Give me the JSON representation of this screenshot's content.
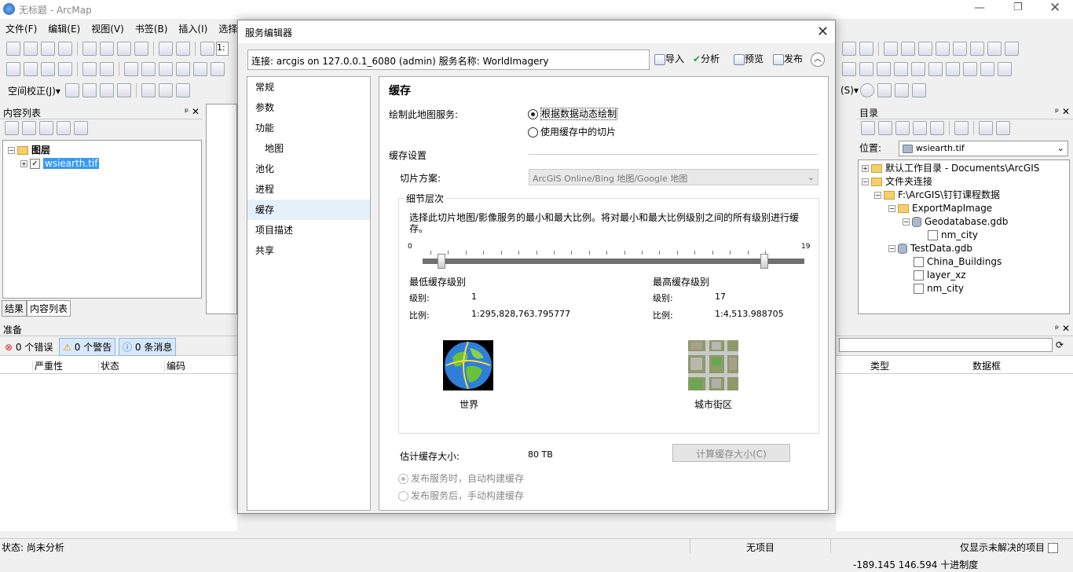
{
  "app": {
    "title": "无标题 - ArcMap"
  },
  "menu": [
    "文件(F)",
    "编辑(E)",
    "视图(V)",
    "书签(B)",
    "插入(I)",
    "选择"
  ],
  "toolbar": {
    "spatial_adjust": "空间校正(J)▾",
    "scale_prefix": "1:",
    "s_label": "(S)▾"
  },
  "toc": {
    "title": "内容列表",
    "layers_label": "图层",
    "layer_item": "wsiearth.tif",
    "tab_results": "结果",
    "tab_toc": "内容列表"
  },
  "prep": {
    "title": "准备",
    "errors": "0 个错误",
    "warnings": "0 个警告",
    "messages": "0 条消息",
    "columns": [
      "严重性",
      "状态",
      "编码"
    ],
    "columns_right": [
      "类型",
      "数据框"
    ]
  },
  "catalog": {
    "title": "目录",
    "location_label": "位置:",
    "location_value": "wsiearth.tif",
    "tree": [
      "默认工作目录 - Documents\\ArcGIS",
      "文件夹连接",
      "F:\\ArcGIS\\钉钉课程数据",
      "ExportMapImage",
      "Geodatabase.gdb",
      "nm_city",
      "TestData.gdb",
      "China_Buildings",
      "layer_xz",
      "nm_city"
    ]
  },
  "dialog": {
    "title": "服务编辑器",
    "connection": "连接: arcgis on 127.0.0.1_6080 (admin)   服务名称: WorldImagery",
    "import": "导入",
    "analyze": "分析",
    "preview": "预览",
    "publish": "发布",
    "nav": [
      "常规",
      "参数",
      "功能",
      "地图",
      "池化",
      "进程",
      "缓存",
      "项目描述",
      "共享"
    ],
    "cache": {
      "heading": "缓存",
      "draw_label": "绘制此地图服务:",
      "opt_dynamic": "根据数据动态绘制",
      "opt_cache": "使用缓存中的切片",
      "settings_label": "缓存设置",
      "scheme_label": "切片方案:",
      "scheme_value": "ArcGIS Online/Bing 地图/Google 地图",
      "lod_title": "细节层次",
      "lod_desc_1": "选择此切片地图/影像服务的最小和最大比例。将对最小和最大比例级别之间的所有级别进行缓",
      "lod_desc_2": "存。",
      "slider_min": "0",
      "slider_max": "19",
      "min_level": 0.05,
      "max_level": 0.895,
      "min_title": "最低缓存级别",
      "max_title": "最高缓存级别",
      "level_label": "级别:",
      "scale_label": "比例:",
      "min_level_value": "1",
      "max_level_value": "17",
      "min_scale": "1:295,828,763.795777",
      "max_scale": "1:4,513.988705",
      "world_label": "世界",
      "city_label": "城市街区",
      "est_label": "估计缓存大小:",
      "est_value": "80 TB",
      "calc_button": "计算缓存大小(C)",
      "auto_build": "发布服务时，自动构建缓存",
      "manual_build": "发布服务后，手动构建缓存"
    }
  },
  "status": {
    "left": "状态: 尚未分析",
    "center": "无项目",
    "right": "仅显示未解决的项目"
  },
  "coords": "-189.145  146.594 十进制度"
}
